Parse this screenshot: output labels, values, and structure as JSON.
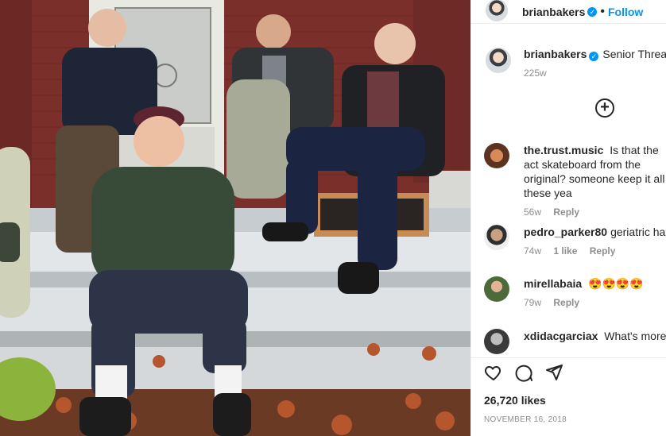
{
  "header": {
    "username": "brianbakers",
    "follow_label": "Follow",
    "separator": "•"
  },
  "caption": {
    "username": "brianbakers",
    "text": "Senior Threat",
    "age": "225w"
  },
  "comments": [
    {
      "username": "the.trust.music",
      "text": "Is that the act skateboard from the original? someone keep it all these yea",
      "age": "56w",
      "likes": "",
      "reply": "Reply"
    },
    {
      "username": "pedro_parker80",
      "text": "geriatric haza",
      "age": "74w",
      "likes": "1 like",
      "reply": "Reply"
    },
    {
      "username": "mirellabaia",
      "text": "😍😍😍😍",
      "age": "79w",
      "likes": "",
      "reply": "Reply"
    },
    {
      "username": "xdidacgarciax",
      "text": "What's more a",
      "age": "",
      "likes": "",
      "reply": ""
    }
  ],
  "likes": "26,720 likes",
  "date": "NOVEMBER 16, 2018",
  "icons": {
    "verified": "verified-badge",
    "more": "plus-circle-icon",
    "like": "heart-icon",
    "comment": "comment-icon",
    "share": "send-icon"
  }
}
